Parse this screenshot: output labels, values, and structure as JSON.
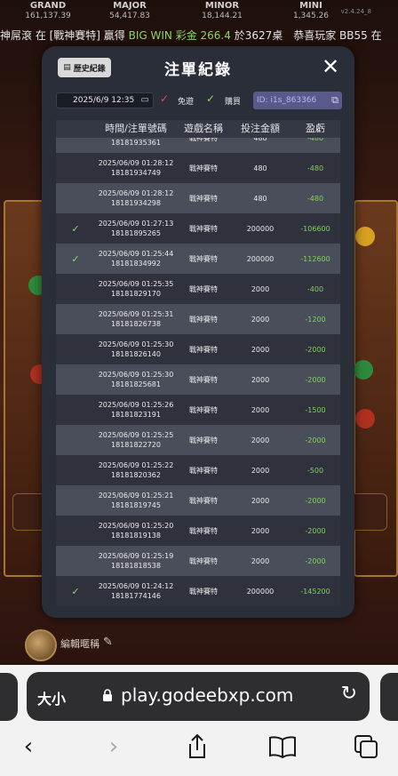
{
  "jackpots": [
    {
      "name": "GRAND",
      "value": "161,137.39"
    },
    {
      "name": "MAJOR",
      "value": "54,417.83"
    },
    {
      "name": "MINOR",
      "value": "18,144.21"
    },
    {
      "name": "MINI",
      "value": "1,345.26"
    }
  ],
  "version": "v2.4.24_8",
  "marquee": {
    "pre": "神屌滾 在 [戰神賽特] 贏得 ",
    "highlight": "BIG WIN 彩金 266.4",
    "post": " 於3627桌",
    "tail": "恭喜玩家 BB55 在"
  },
  "modal": {
    "history_label": "歷史紀錄",
    "title": "注單紀錄",
    "date_value": "2025/6/9 12:35",
    "free_spin_label": "免遊",
    "purchase_label": "購買",
    "id_text": "ID: i1s_863366",
    "columns": [
      "時間/注單號碼",
      "遊戲名稱",
      "投注金額",
      "盈虧"
    ],
    "rows": [
      {
        "time": "2025/06/09 01:28:13",
        "ticket": "18181935361",
        "game": "戰神賽特",
        "bet": "480",
        "win": "-480",
        "checked": false
      },
      {
        "time": "2025/06/09 01:28:12",
        "ticket": "18181934749",
        "game": "戰神賽特",
        "bet": "480",
        "win": "-480",
        "checked": false
      },
      {
        "time": "2025/06/09 01:28:12",
        "ticket": "18181934298",
        "game": "戰神賽特",
        "bet": "480",
        "win": "-480",
        "checked": false
      },
      {
        "time": "2025/06/09 01:27:13",
        "ticket": "18181895265",
        "game": "戰神賽特",
        "bet": "200000",
        "win": "-106600",
        "checked": true
      },
      {
        "time": "2025/06/09 01:25:44",
        "ticket": "18181834992",
        "game": "戰神賽特",
        "bet": "200000",
        "win": "-112600",
        "checked": true
      },
      {
        "time": "2025/06/09 01:25:35",
        "ticket": "18181829170",
        "game": "戰神賽特",
        "bet": "2000",
        "win": "-400",
        "checked": false
      },
      {
        "time": "2025/06/09 01:25:31",
        "ticket": "18181826738",
        "game": "戰神賽特",
        "bet": "2000",
        "win": "-1200",
        "checked": false
      },
      {
        "time": "2025/06/09 01:25:30",
        "ticket": "18181826140",
        "game": "戰神賽特",
        "bet": "2000",
        "win": "-2000",
        "checked": false
      },
      {
        "time": "2025/06/09 01:25:30",
        "ticket": "18181825681",
        "game": "戰神賽特",
        "bet": "2000",
        "win": "-2000",
        "checked": false
      },
      {
        "time": "2025/06/09 01:25:26",
        "ticket": "18181823191",
        "game": "戰神賽特",
        "bet": "2000",
        "win": "-1500",
        "checked": false
      },
      {
        "time": "2025/06/09 01:25:25",
        "ticket": "18181822720",
        "game": "戰神賽特",
        "bet": "2000",
        "win": "-2000",
        "checked": false
      },
      {
        "time": "2025/06/09 01:25:22",
        "ticket": "18181820362",
        "game": "戰神賽特",
        "bet": "2000",
        "win": "-500",
        "checked": false
      },
      {
        "time": "2025/06/09 01:25:21",
        "ticket": "18181819745",
        "game": "戰神賽特",
        "bet": "2000",
        "win": "-2000",
        "checked": false
      },
      {
        "time": "2025/06/09 01:25:20",
        "ticket": "18181819138",
        "game": "戰神賽特",
        "bet": "2000",
        "win": "-2000",
        "checked": false
      },
      {
        "time": "2025/06/09 01:25:19",
        "ticket": "18181818538",
        "game": "戰神賽特",
        "bet": "2000",
        "win": "-2000",
        "checked": false
      },
      {
        "time": "2025/06/09 01:24:12",
        "ticket": "18181774146",
        "game": "戰神賽特",
        "bet": "200000",
        "win": "-145200",
        "checked": true
      }
    ]
  },
  "edit_nickname_label": "編輯暱稱",
  "browser": {
    "text_size_label": "大小",
    "url": "play.godeebxp.com"
  },
  "colors": {
    "win_green": "#7fd25c",
    "check_green": "#8fd66b",
    "modal_bg": "#2a2e39"
  }
}
